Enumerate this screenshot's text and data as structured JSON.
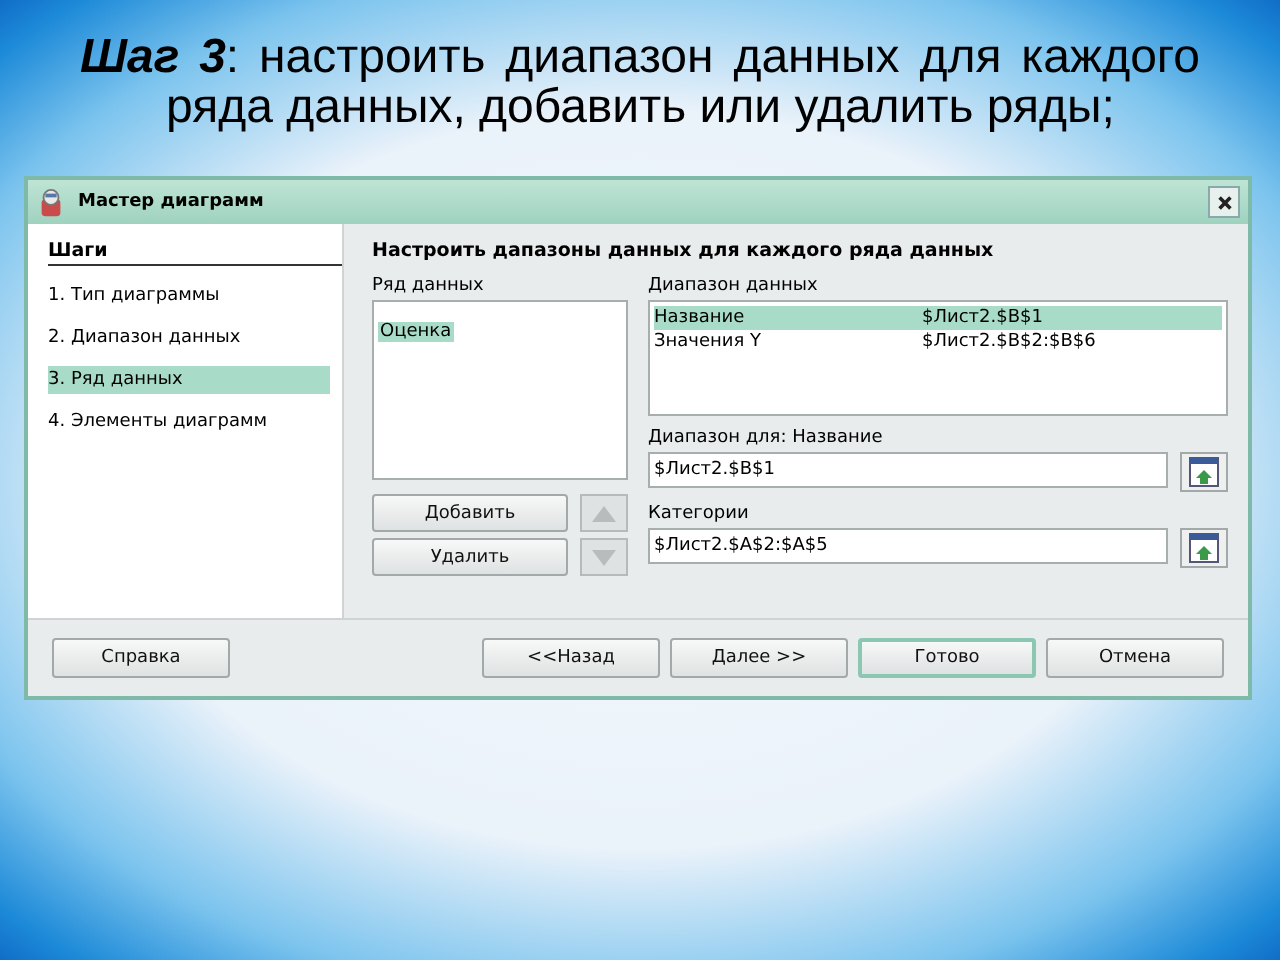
{
  "slide": {
    "heading": "**Шаг 3**: настроить диапазон данных для каждого ряда данных, добавить или удалить ряды;"
  },
  "dialog": {
    "title": "Мастер диаграмм",
    "steps_heading": "Шаги",
    "steps": [
      {
        "label": "1.  Тип диаграммы",
        "selected": false
      },
      {
        "label": "2.  Диапазон данных",
        "selected": false
      },
      {
        "label": "3.  Ряд данных",
        "selected": true
      },
      {
        "label": "4.  Элементы диаграмм",
        "selected": false
      }
    ],
    "page_title": "Настроить дапазоны данных для каждого ряда данных",
    "series_label": "Ряд данных",
    "series": [
      {
        "name": "Оценка",
        "selected": true
      }
    ],
    "ranges_label": "Диапазон данных",
    "ranges": [
      {
        "role": "Название",
        "range": "$Лист2.$B$1",
        "selected": true
      },
      {
        "role": "Значения Y",
        "range": "$Лист2.$B$2:$B$6",
        "selected": false
      }
    ],
    "range_for_label": "Диапазон для: Название",
    "range_for_value": "$Лист2.$B$1",
    "categories_label": "Категории",
    "categories_value": "$Лист2.$A$2:$A$5",
    "series_buttons": [
      "Добавить",
      "Удалить"
    ],
    "move_buttons": [
      {
        "kind": "up",
        "disabled": true
      },
      {
        "kind": "down",
        "disabled": true
      }
    ],
    "footer_buttons": [
      {
        "label": "Справка",
        "default": false
      },
      {
        "label": "<<Назад",
        "default": false
      },
      {
        "label": "Далее >>",
        "default": false
      },
      {
        "label": "Готово",
        "default": true
      },
      {
        "label": "Отмена",
        "default": false
      }
    ]
  }
}
